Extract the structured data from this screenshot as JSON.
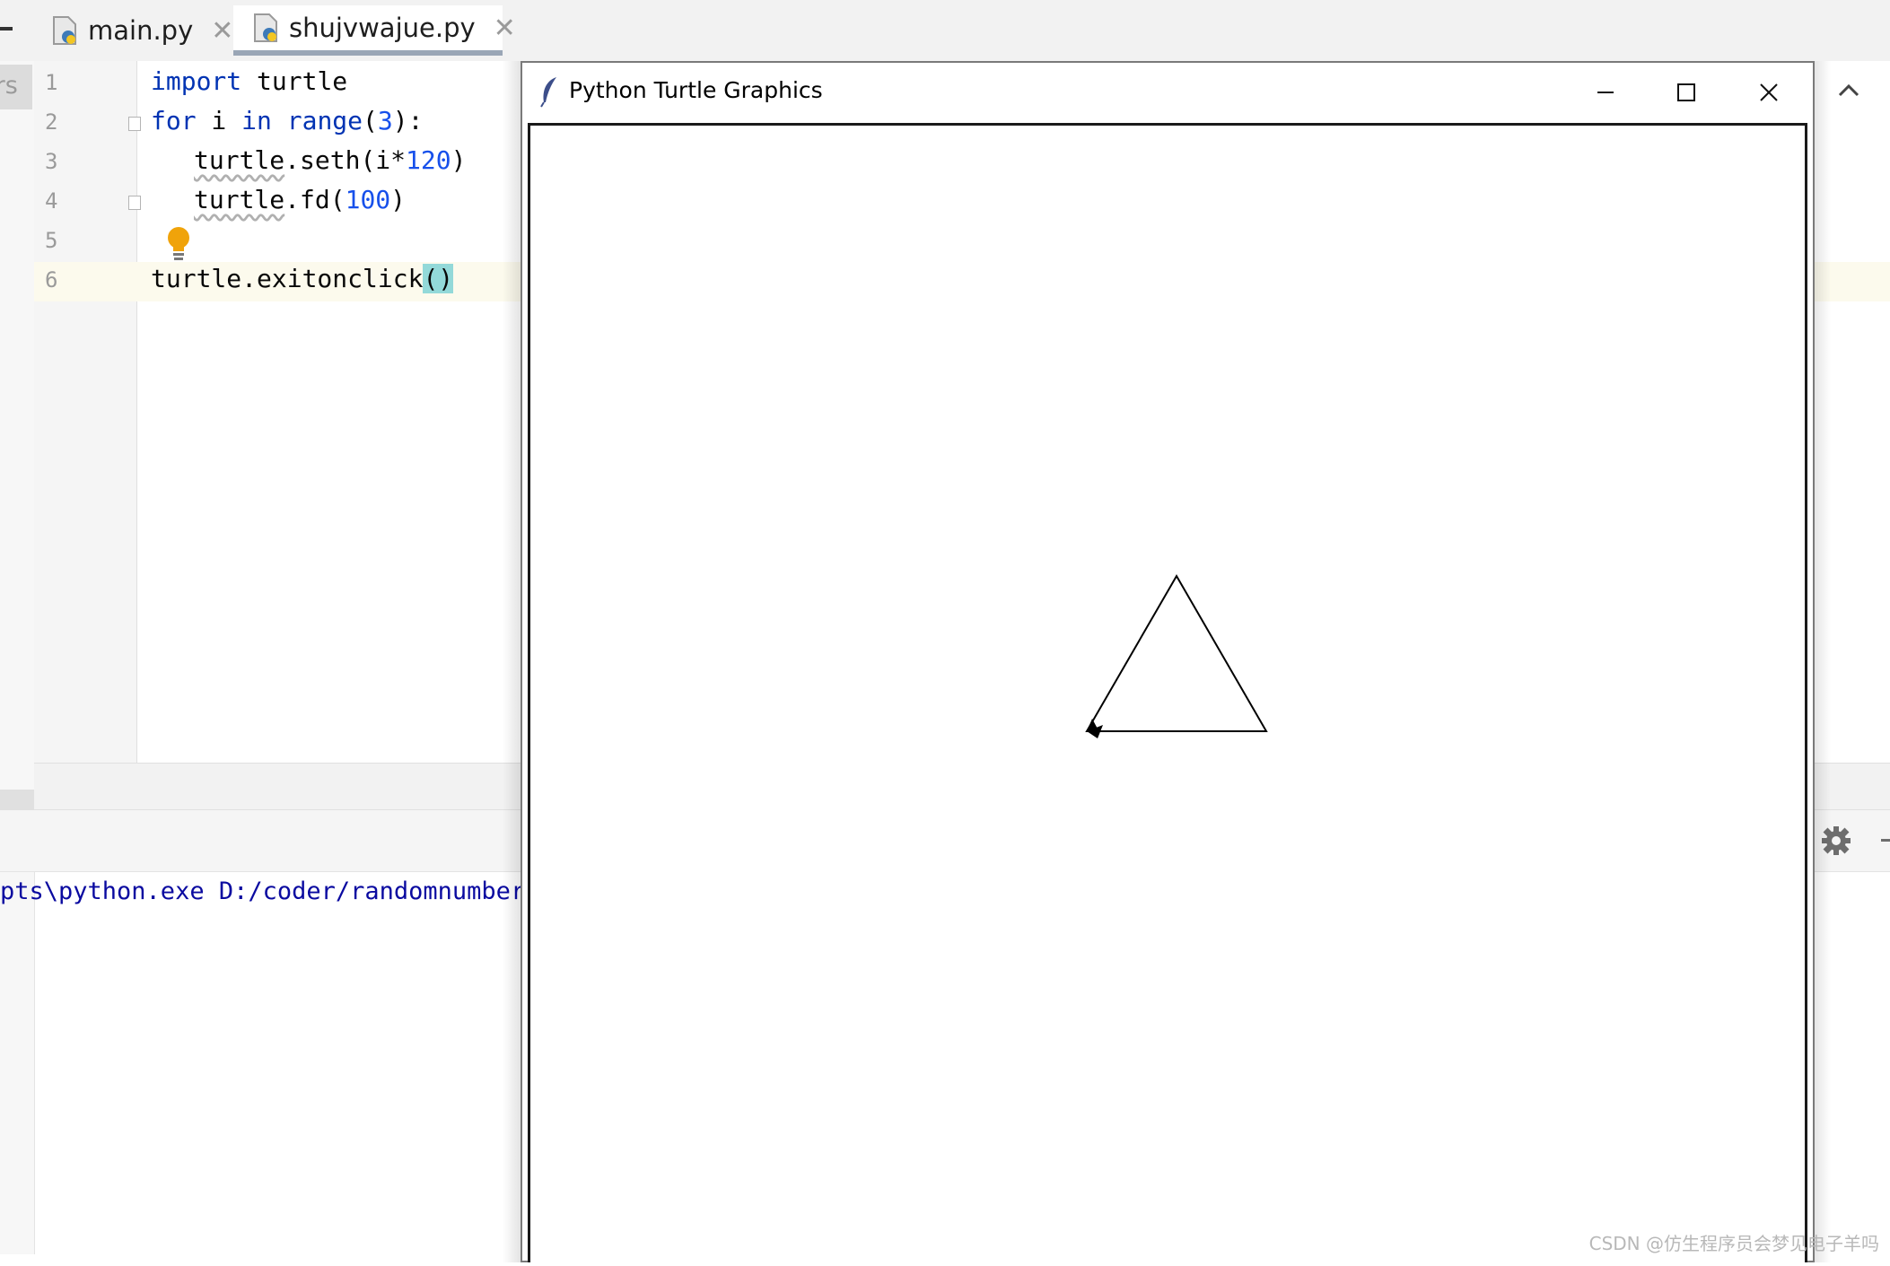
{
  "tabs": [
    {
      "label": "main.py"
    },
    {
      "label": "shujvwajue.py",
      "active": true
    }
  ],
  "sidebar_label": "ers",
  "line_numbers": [
    "1",
    "2",
    "3",
    "4",
    "5",
    "6"
  ],
  "code": {
    "l1_kw": "import",
    "l1_rest": " turtle",
    "l2_kw1": "for",
    "l2_mid": " i ",
    "l2_kw2": "in",
    "l2_fn": " range",
    "l2_open": "(",
    "l2_num": "3",
    "l2_close": "):",
    "l3_obj": "turtle",
    "l3_call": ".seth(i*",
    "l3_num": "120",
    "l3_end": ")",
    "l4_obj": "turtle",
    "l4_call": ".fd(",
    "l4_num": "100",
    "l4_end": ")",
    "l6_text": "turtle.exitonclick",
    "l6_parens": "()"
  },
  "console": {
    "command": "pts\\python.exe D:/coder/randomnumber"
  },
  "turtle_window": {
    "title": "Python Turtle Graphics",
    "minimize_glyph": "—",
    "maximize_glyph": "☐",
    "close_glyph": "✕"
  },
  "drawing": {
    "description_shape": "triangle",
    "turns": 3,
    "side_length": 100,
    "heading_step": 120,
    "stroke_color": "#000000"
  },
  "colors": {
    "keyword": "#0033b3",
    "number": "#1750eb",
    "bracket_highlight": "#93d9d9",
    "current_line": "#fcfaed",
    "console_text": "#0a0aa0",
    "bulb": "#f0a30a"
  },
  "watermark": "CSDN @仿生程序员会梦见电子羊吗"
}
